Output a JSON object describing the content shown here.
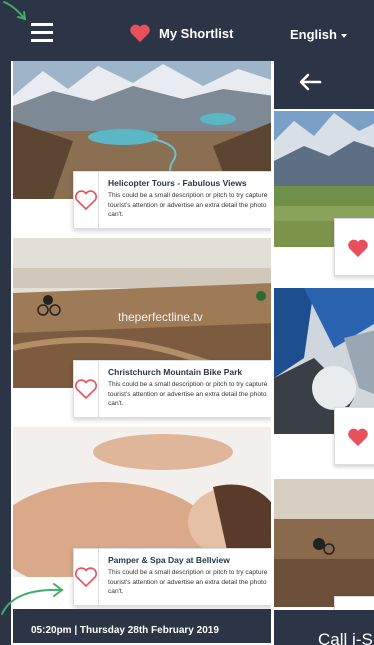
{
  "header": {
    "title": "My Shortlist",
    "language": "English",
    "menu_icon": "hamburger-icon",
    "title_icon": "heart-icon"
  },
  "cards": [
    {
      "title": "Helicopter Tours - Fabulous Views",
      "description": "This could be a small description or pitch to try capture tourist's attention or advertise an extra detail the photo can't.",
      "image": "mountain-lake-landscape"
    },
    {
      "title": "Christchurch Mountain Bike Park",
      "description": "This could be a small description or pitch to try capture tourist's attention or advertise an extra detail the photo can't.",
      "image": "mountain-bike-trail",
      "watermark": "theperfectline.tv"
    },
    {
      "title": "Pamper & Spa Day at Bellview",
      "description": "This could be a small description or pitch to try capture tourist's attention or advertise an extra detail the photo can't.",
      "image": "spa-massage"
    }
  ],
  "footer": {
    "datetime": "05:20pm  |  Thursday 28th February 2019"
  },
  "second_screen": {
    "back_icon": "back-arrow-icon",
    "footer_text": "Call i-S"
  },
  "colors": {
    "navy": "#2b3546",
    "heart": "#e8505b",
    "annotation_green": "#3fae6a"
  }
}
